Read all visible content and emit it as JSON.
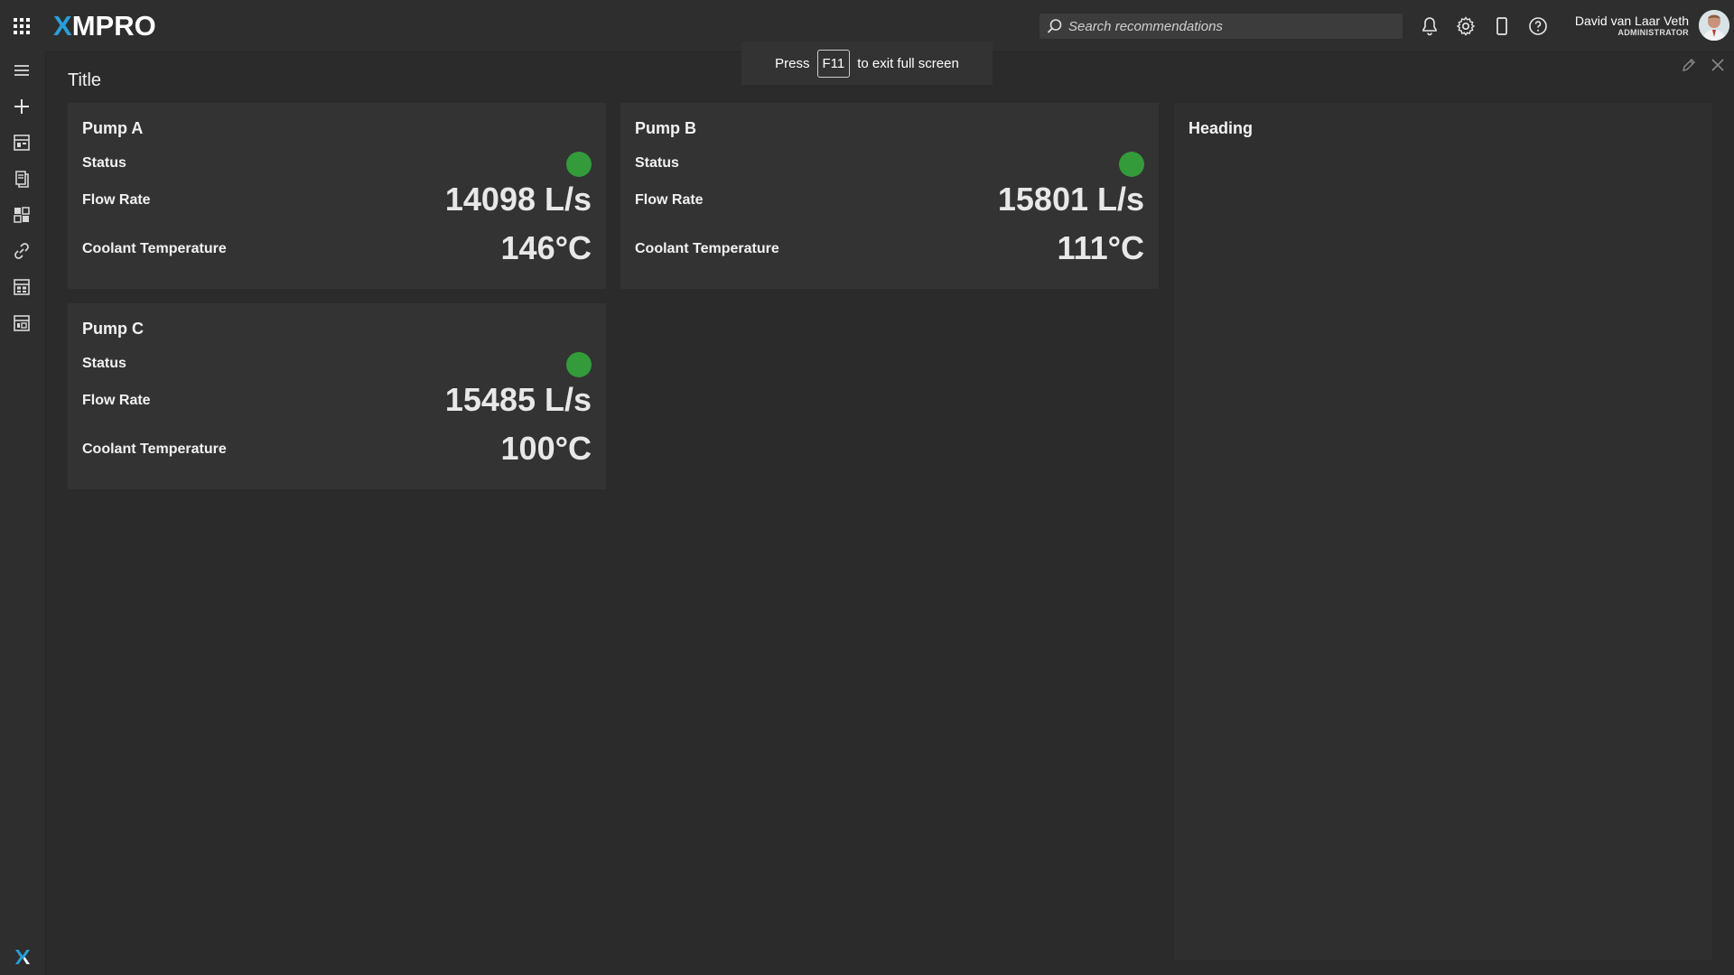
{
  "app": {
    "logo_text": "MPRO",
    "logo_prefix": "X"
  },
  "search": {
    "placeholder": "Search recommendations"
  },
  "user": {
    "name": "David van Laar Veth",
    "role": "ADMINISTRATOR"
  },
  "toast": {
    "prefix": "Press",
    "key": "F11",
    "suffix": "to exit full screen"
  },
  "page": {
    "title": "Title"
  },
  "pumps": [
    {
      "name": "Pump A",
      "status_label": "Status",
      "status_color": "#339b3a",
      "flow_label": "Flow Rate",
      "flow_value": "14098 L/s",
      "temp_label": "Coolant Temperature",
      "temp_value": "146°C"
    },
    {
      "name": "Pump B",
      "status_label": "Status",
      "status_color": "#339b3a",
      "flow_label": "Flow Rate",
      "flow_value": "15801 L/s",
      "temp_label": "Coolant Temperature",
      "temp_value": "111°C"
    },
    {
      "name": "Pump C",
      "status_label": "Status",
      "status_color": "#339b3a",
      "flow_label": "Flow Rate",
      "flow_value": "15485 L/s",
      "temp_label": "Coolant Temperature",
      "temp_value": "100°C"
    }
  ],
  "side_panel": {
    "heading": "Heading"
  },
  "icons": {
    "topbar": [
      "apps-grid-icon",
      "search-icon",
      "bell-icon",
      "gear-icon",
      "mobile-icon",
      "help-icon"
    ],
    "sidebar": [
      "menu-icon",
      "plus-icon",
      "recommendations-icon",
      "data-stream-icon",
      "apps-icon",
      "link-icon",
      "table-icon",
      "dashboard-icon",
      "xmpro-mark-icon"
    ],
    "page": [
      "edit-icon",
      "close-icon"
    ]
  },
  "colors": {
    "accent": "#2a9fd6",
    "status_ok": "#339b3a",
    "background": "#2b2b2b",
    "card": "#333333"
  }
}
